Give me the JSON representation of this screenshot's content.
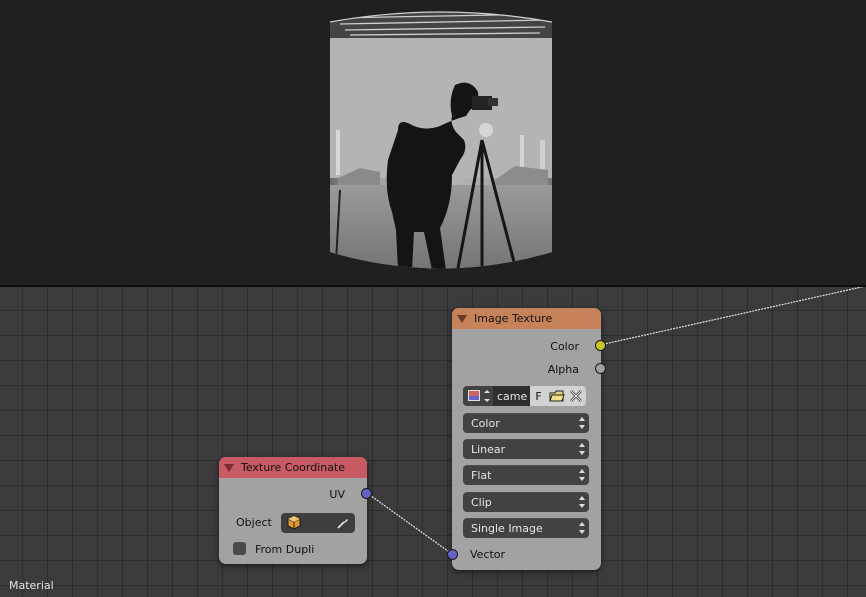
{
  "editor": {
    "status_label": "Material"
  },
  "image_texture_node": {
    "title": "Image Texture",
    "header_color": "#c8825a",
    "outputs": [
      {
        "label": "Color",
        "socket_color": "#c7c729"
      },
      {
        "label": "Alpha",
        "socket_color": "#a0a0a0"
      }
    ],
    "image": {
      "browse_icon": "image-browse-icon",
      "name": "came",
      "fake_user": "F",
      "open_icon": "folder-open-icon",
      "unlink_icon": "close-icon"
    },
    "color_space": "Color",
    "interpolation": "Linear",
    "projection": "Flat",
    "extension": "Clip",
    "source": "Single Image",
    "input": {
      "label": "Vector",
      "socket_color": "#6363c7"
    }
  },
  "texture_coordinate_node": {
    "title": "Texture Coordinate",
    "header_color": "#c85a64",
    "output": {
      "label": "UV",
      "socket_color": "#6363c7"
    },
    "object_label": "Object",
    "object_icon": "object-cube-icon",
    "eyedropper_icon": "eyedropper-icon",
    "from_dupli_label": "From Dupli",
    "from_dupli_checked": false
  }
}
